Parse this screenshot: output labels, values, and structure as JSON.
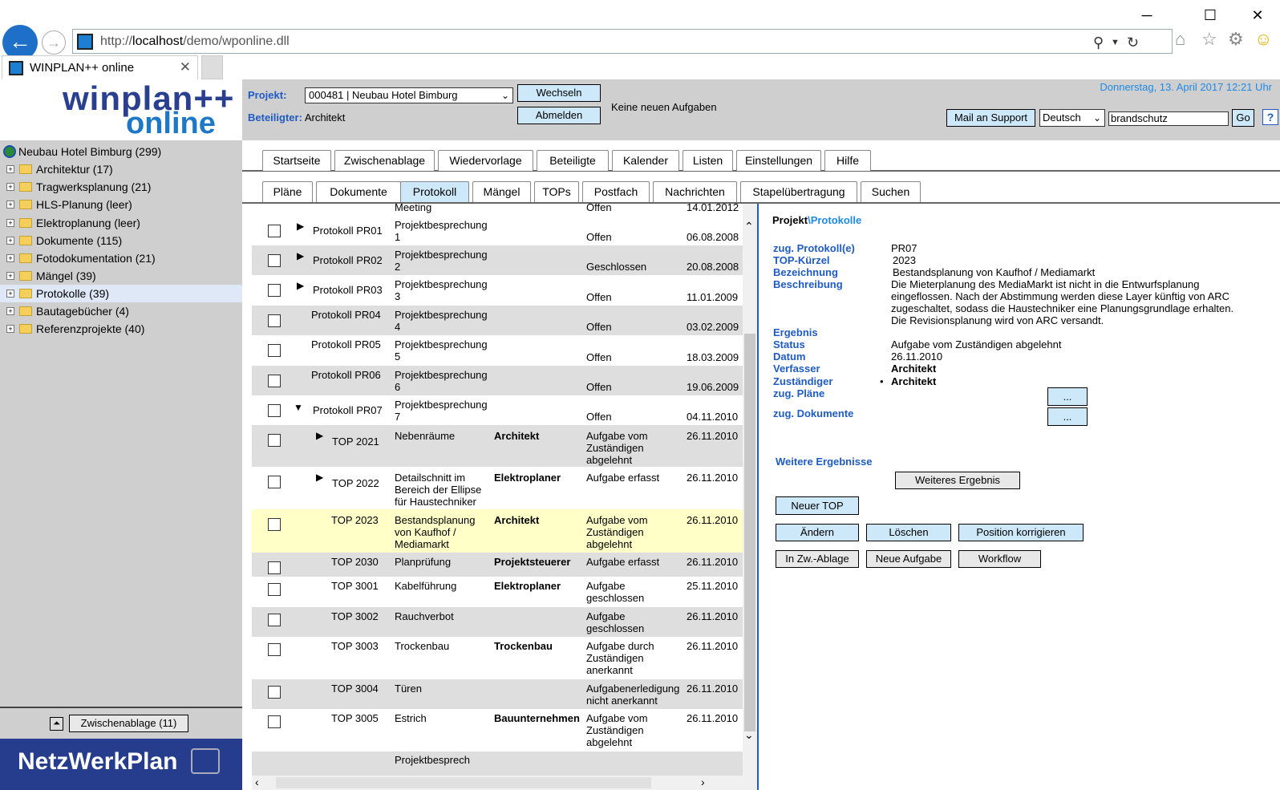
{
  "browser": {
    "url_prefix": "http://",
    "url_host": "localhost",
    "url_path": "/demo/wponline.dll",
    "tab_title": "WINPLAN++ online"
  },
  "logo": {
    "line1": "winplan++",
    "line2": "online"
  },
  "tree": {
    "root": "Neubau Hotel Bimburg (299)",
    "items": [
      {
        "label": "Architektur (17)"
      },
      {
        "label": "Tragwerksplanung  (21)"
      },
      {
        "label": "HLS-Planung (leer)"
      },
      {
        "label": "Elektroplanung  (leer)"
      },
      {
        "label": "Dokumente (115)"
      },
      {
        "label": "Fotodokumentation  (21)"
      },
      {
        "label": "Mängel (39)"
      },
      {
        "label": "Protokolle (39)"
      },
      {
        "label": "Bautagebücher  (4)"
      },
      {
        "label": "Referenzprojekte  (40)"
      }
    ]
  },
  "left_bottom": {
    "clipboard_button": "Zwischenablage (11)"
  },
  "brand": "NetzWerkPlan",
  "header": {
    "project_label": "Projekt:",
    "project_value": "000481 | Neubau Hotel Bimburg",
    "participant_label": "Beteiligter:",
    "participant_value": "Architekt",
    "switch_button": "Wechseln",
    "logout_button": "Abmelden",
    "tasks_text": "Keine neuen Aufgaben",
    "date": "Donnerstag, 13. April 2017 12:21 Uhr",
    "mail_button": "Mail an Support",
    "language": "Deutsch",
    "search_value": "brandschutz",
    "go_button": "Go",
    "help": "?"
  },
  "tabs_main": [
    "Startseite",
    "Zwischenablage",
    "Wiedervorlage",
    "Beteiligte",
    "Kalender",
    "Listen",
    "Einstellungen",
    "Hilfe"
  ],
  "tabs_sub": [
    "Pläne",
    "Dokumente",
    "Protokoll",
    "Mängel",
    "TOPs",
    "Postfach",
    "Nachrichten",
    "Stapelübertragung",
    "Suchen"
  ],
  "list": {
    "top_partial": {
      "c2": "Meeting",
      "c4": "Offen",
      "c5": "14.01.2012"
    },
    "rows": [
      {
        "c1": "Protokoll PR01",
        "c2": "Projektbesprechung 1",
        "c3": "",
        "c4": "Offen",
        "c5": "06.08.2008"
      },
      {
        "c1": "Protokoll PR02",
        "c2": "Projektbesprechung 2",
        "c3": "",
        "c4": "Geschlossen",
        "c5": "20.08.2008"
      },
      {
        "c1": "Protokoll PR03",
        "c2": "Projektbesprechung 3",
        "c3": "",
        "c4": "Offen",
        "c5": "11.01.2009"
      },
      {
        "c1": "Protokoll PR04",
        "c2": "Projektbesprechung 4",
        "c3": "",
        "c4": "Offen",
        "c5": "03.02.2009"
      },
      {
        "c1": "Protokoll PR05",
        "c2": "Projektbesprechung 5",
        "c3": "",
        "c4": "Offen",
        "c5": "18.03.2009"
      },
      {
        "c1": "Protokoll PR06",
        "c2": "Projektbesprechung 6",
        "c3": "",
        "c4": "Offen",
        "c5": "19.06.2009"
      },
      {
        "c1": "Protokoll PR07",
        "c2": "Projektbesprechung 7",
        "c3": "",
        "c4": "Offen",
        "c5": "04.11.2010"
      },
      {
        "c1": "TOP 2021",
        "c2": "Nebenräume",
        "c3": "Architekt",
        "c4": "Aufgabe vom Zuständigen abgelehnt",
        "c5": "26.11.2010"
      },
      {
        "c1": "TOP 2022",
        "c2": "Detailschnitt im Bereich der Ellipse für Haustechniker",
        "c3": "Elektroplaner",
        "c4": "Aufgabe erfasst",
        "c5": "26.11.2010"
      },
      {
        "c1": "TOP 2023",
        "c2": "Bestandsplanung von Kaufhof / Mediamarkt",
        "c3": "Architekt",
        "c4": "Aufgabe vom Zuständigen abgelehnt",
        "c5": "26.11.2010"
      },
      {
        "c1": "TOP 2030",
        "c2": "Planprüfung",
        "c3": "Projektsteuerer",
        "c4": "Aufgabe erfasst",
        "c5": "26.11.2010"
      },
      {
        "c1": "TOP 3001",
        "c2": "Kabelführung",
        "c3": "Elektroplaner",
        "c4": "Aufgabe geschlossen",
        "c5": "25.11.2010"
      },
      {
        "c1": "TOP 3002",
        "c2": "Rauchverbot",
        "c3": "",
        "c4": "Aufgabe geschlossen",
        "c5": "26.11.2010"
      },
      {
        "c1": "TOP 3003",
        "c2": "Trockenbau",
        "c3": "Trockenbau",
        "c4": "Aufgabe durch Zuständigen anerkannt",
        "c5": "26.11.2010"
      },
      {
        "c1": "TOP 3004",
        "c2": "Türen",
        "c3": "",
        "c4": "Aufgabenerledigung nicht anerkannt",
        "c5": "26.11.2010"
      },
      {
        "c1": "TOP 3005",
        "c2": "Estrich",
        "c3": "Bauunternehmen",
        "c4": "Aufgabe vom Zuständigen abgelehnt",
        "c5": "26.11.2010"
      }
    ],
    "bottom_partial": "Projektbesprech"
  },
  "detail": {
    "crumb_a": "Projekt",
    "crumb_b": "\\Protokolle",
    "labels": {
      "protokoll": "zug. Protokoll(e)",
      "kuerzel": "TOP-Kürzel",
      "bezeichnung": "Bezeichnung",
      "beschreibung": "Beschreibung",
      "ergebnis": "Ergebnis",
      "status": "Status",
      "datum": "Datum",
      "verfasser": "Verfasser",
      "zustaendiger": "Zuständiger",
      "plaene": "zug. Pläne",
      "dokumente": "zug. Dokumente"
    },
    "values": {
      "protokoll": "PR07",
      "kuerzel": "2023",
      "bezeichnung": "Bestandsplanung von Kaufhof / Mediamarkt",
      "beschreibung": "Die Mieterplanung des MediaMarkt ist nicht in die Entwurfsplanung eingeflossen. Nach der Abstimmung werden diese Layer künftig von ARC zugeschaltet, sodass die Haustechniker eine Planungsgrundlage erhalten. Die Revisionsplanung wird von ARC versandt.",
      "status": "Aufgabe vom Zuständigen abgelehnt",
      "datum": "26.11.2010",
      "verfasser": "Architekt",
      "zustaendiger": "Architekt"
    },
    "ellipsis": "...",
    "more_results_label": "Weitere Ergebnisse",
    "more_result_button": "Weiteres Ergebnis",
    "new_top_button": "Neuer TOP",
    "change_button": "Ändern",
    "delete_button": "Löschen",
    "fix_position_button": "Position korrigieren",
    "to_clipboard_button": "In Zw.-Ablage",
    "new_task_button": "Neue Aufgabe",
    "workflow_button": "Workflow"
  }
}
